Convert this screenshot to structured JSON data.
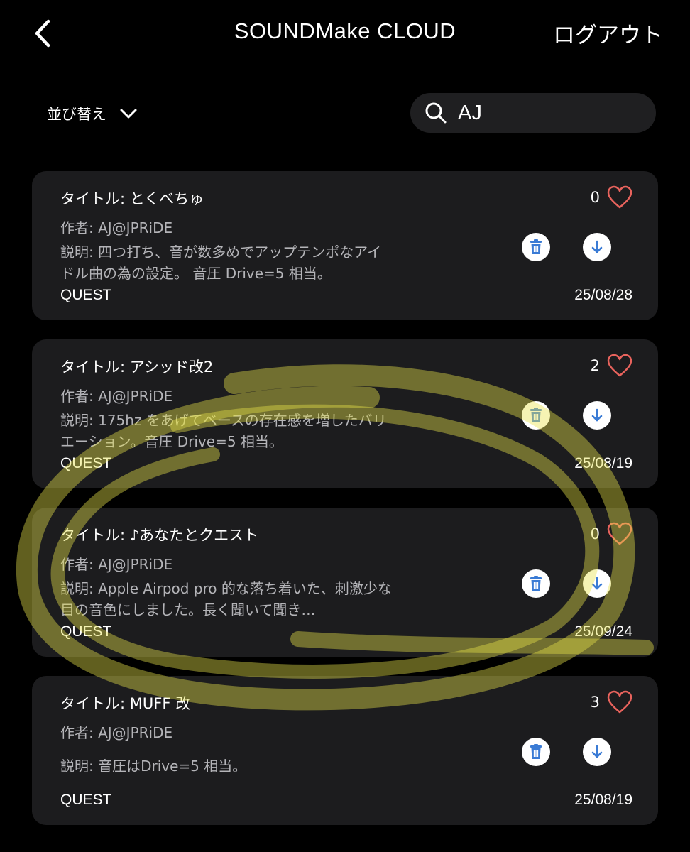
{
  "header": {
    "title": "SOUNDMake CLOUD",
    "logout_label": "ログアウト",
    "back_icon": "chevron-left-icon"
  },
  "toolbar": {
    "sort_label": "並び替え",
    "sort_icon": "chevron-down-icon",
    "search_value": "AJ",
    "search_icon": "search-icon"
  },
  "colors": {
    "background": "#000000",
    "card": "#1c1c1e",
    "heart": "#e8635d",
    "action_icon": "#3a7bd5",
    "highlight": "#e6e34a"
  },
  "cards": [
    {
      "title": "タイトル: とくべちゅ",
      "author": "作者: AJ@JPRiDE",
      "description": "説明: 四つ打ち、音が数多めでアップテンポなアイドル曲の為の設定。 音圧 Drive=5 相当。",
      "platform": "QUEST",
      "date": "25/08/28",
      "likes": "0"
    },
    {
      "title": "タイトル: アシッド改2",
      "author": "作者: AJ@JPRiDE",
      "description": "説明: 175hz をあげてベースの存在感を増したバリエーション。音圧 Drive=5 相当。",
      "platform": "QUEST",
      "date": "25/08/19",
      "likes": "2"
    },
    {
      "title": "タイトル: ♪あなたとクエスト",
      "author": "作者: AJ@JPRiDE",
      "description": "説明: Apple Airpod pro 的な落ち着いた、刺激少な目の音色にしました。長く聞いて聞き…",
      "platform": "QUEST",
      "date": "25/09/24",
      "likes": "0"
    },
    {
      "title": "タイトル: MUFF 改",
      "author": "作者: AJ@JPRiDE",
      "description": "説明: 音圧はDrive=5 相当。",
      "platform": "QUEST",
      "date": "25/08/19",
      "likes": "3"
    }
  ]
}
